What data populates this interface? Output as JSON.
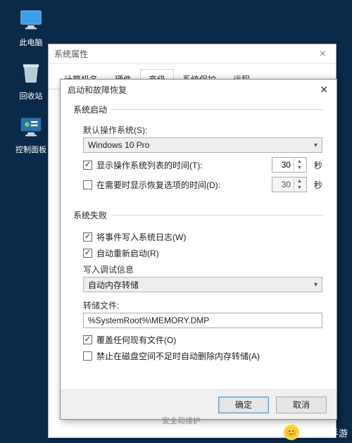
{
  "desktop": {
    "pc_label": "此电脑",
    "recycle_label": "回收站",
    "cpanel_label": "控制面板"
  },
  "props_window": {
    "title": "系统属性",
    "tabs": [
      "计算机名",
      "硬件",
      "高级",
      "系统保护",
      "远程"
    ]
  },
  "startup_window": {
    "title": "启动和故障恢复",
    "sec_startup": "系统启动",
    "default_os_label": "默认操作系统(S):",
    "default_os_value": "Windows 10 Pro",
    "show_os_list_label": "显示操作系统列表的时间(T):",
    "show_os_list_value": "30",
    "show_recovery_label": "在需要时显示恢复选项的时间(D):",
    "show_recovery_value": "30",
    "unit_sec": "秒",
    "sec_failure": "系统失败",
    "write_event_label": "将事件写入系统日志(W)",
    "auto_restart_label": "自动重新启动(R)",
    "debug_info_label": "写入调试信息",
    "debug_info_value": "自动内存转储",
    "dump_file_label": "转储文件:",
    "dump_file_value": "%SystemRoot%\\MEMORY.DMP",
    "overwrite_label": "覆盖任何现有文件(O)",
    "no_auto_delete_label": "禁止在磁盘空间不足时自动删除内存转储(A)",
    "ok": "确定",
    "cancel": "取消"
  },
  "bg": {
    "security_line": "安全和维护"
  },
  "watermark": {
    "text": "欢乐淘手游"
  }
}
